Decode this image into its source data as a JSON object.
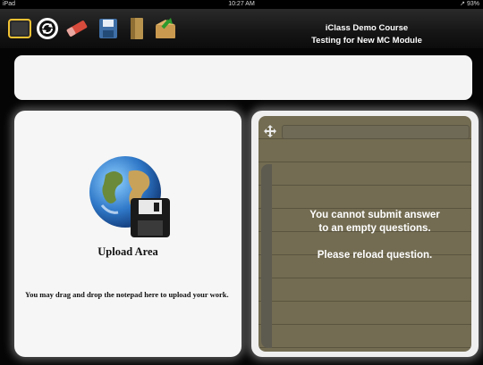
{
  "status_bar": {
    "carrier": "iPad",
    "time": "10:27 AM",
    "battery": "93%"
  },
  "header": {
    "course_title": "iClass Demo Course",
    "module_title": "Testing for New MC Module"
  },
  "toolbar": {
    "buttons": [
      {
        "icon": "notepad-icon"
      },
      {
        "icon": "refresh-icon"
      },
      {
        "icon": "eraser-icon"
      },
      {
        "icon": "save-icon"
      },
      {
        "icon": "folder-icon"
      },
      {
        "icon": "submit-icon"
      }
    ]
  },
  "upload": {
    "title": "Upload Area",
    "note": "You may drag and drop the notepad here to upload your work."
  },
  "notepad": {
    "message_line1": "You cannot submit answer",
    "message_line2": "to an empty questions.",
    "message_line3": "Please reload question."
  },
  "colors": {
    "notepad_bg": "#736c52",
    "panel_bg": "#f4f4f4",
    "toolbar_bg": "#1a1a1a"
  }
}
